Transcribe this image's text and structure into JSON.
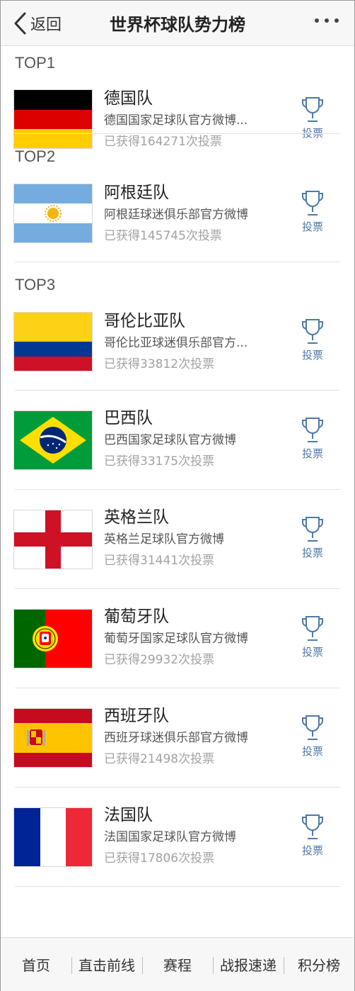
{
  "header": {
    "back_label": "返回",
    "title": "世界杯球队势力榜",
    "more_icon": "more-dots-icon"
  },
  "colors": {
    "vote_accent": "#4f79a8",
    "votes_gray": "#a2a2a2",
    "header_bg": "#f7f7f7"
  },
  "teams": [
    {
      "rank_label": "TOP1",
      "name": "德国队",
      "desc": "德国国家足球队官方微博...",
      "votes": "已获得164271次投票",
      "vote_label": "投票",
      "flag": "germany"
    },
    {
      "rank_label": "TOP2",
      "name": "阿根廷队",
      "desc": "阿根廷球迷俱乐部官方微博",
      "votes": "已获得145745次投票",
      "vote_label": "投票",
      "flag": "argentina"
    },
    {
      "rank_label": "TOP3",
      "name": "哥伦比亚队",
      "desc": "哥伦比亚球迷俱乐部官方...",
      "votes": "已获得33812次投票",
      "vote_label": "投票",
      "flag": "colombia"
    },
    {
      "name": "巴西队",
      "desc": "巴西国家足球队官方微博",
      "votes": "已获得33175次投票",
      "vote_label": "投票",
      "flag": "brazil"
    },
    {
      "name": "英格兰队",
      "desc": "英格兰足球队官方微博",
      "votes": "已获得31441次投票",
      "vote_label": "投票",
      "flag": "england"
    },
    {
      "name": "葡萄牙队",
      "desc": "葡萄牙国家足球队官方微博",
      "votes": "已获得29932次投票",
      "vote_label": "投票",
      "flag": "portugal"
    },
    {
      "name": "西班牙队",
      "desc": "西班牙球迷俱乐部官方微博",
      "votes": "已获得21498次投票",
      "vote_label": "投票",
      "flag": "spain"
    },
    {
      "name": "法国队",
      "desc": "法国国家足球队官方微博",
      "votes": "已获得17806次投票",
      "vote_label": "投票",
      "flag": "france"
    }
  ],
  "tabbar": {
    "tabs": [
      "首页",
      "直击前线",
      "赛程",
      "战报速递",
      "积分榜"
    ]
  }
}
